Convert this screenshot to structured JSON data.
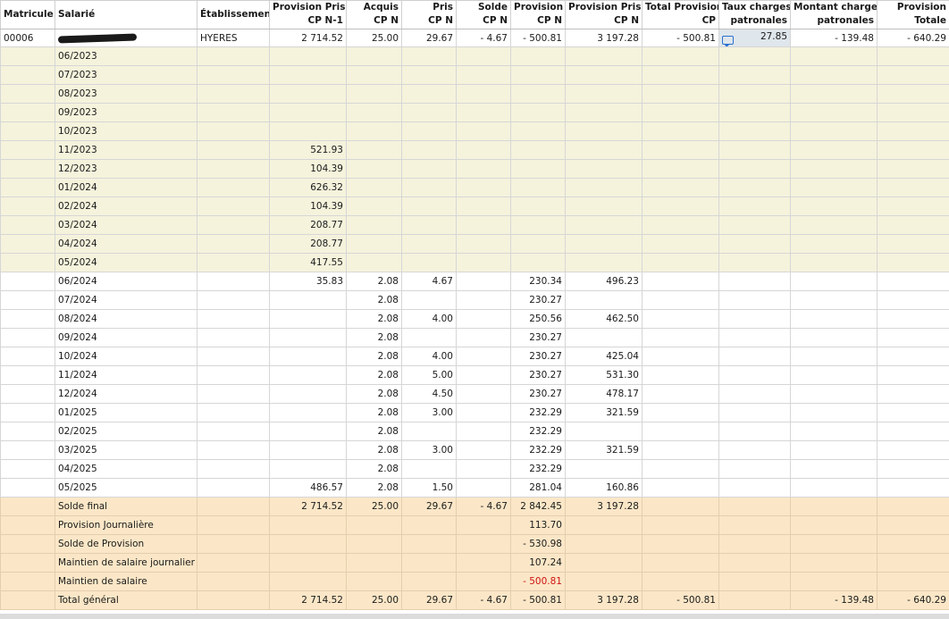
{
  "headers": [
    {
      "l1": "Matricule",
      "l2": "",
      "align": "l"
    },
    {
      "l1": "Salarié",
      "l2": "",
      "align": "l"
    },
    {
      "l1": "Établissement",
      "l2": "",
      "align": "l"
    },
    {
      "l1": "Provision Prise",
      "l2": "CP N-1",
      "align": "r"
    },
    {
      "l1": "Acquis",
      "l2": "CP N",
      "align": "r"
    },
    {
      "l1": "Pris",
      "l2": "CP N",
      "align": "r"
    },
    {
      "l1": "Solde",
      "l2": "CP N",
      "align": "r"
    },
    {
      "l1": "Provision",
      "l2": "CP N",
      "align": "r"
    },
    {
      "l1": "Provision Prise",
      "l2": "CP N",
      "align": "r"
    },
    {
      "l1": "Total Provision",
      "l2": "CP",
      "align": "r"
    },
    {
      "l1": "Taux charges",
      "l2": "patronales",
      "align": "r"
    },
    {
      "l1": "Montant charges",
      "l2": "patronales",
      "align": "r"
    },
    {
      "l1": "Provision",
      "l2": "Totale",
      "align": "r"
    }
  ],
  "employee": {
    "matricule": "00006",
    "etablissement": "HYERES",
    "prov_prise_n1": "2 714.52",
    "acquis": "25.00",
    "pris": "29.67",
    "solde": "- 4.67",
    "provision": "- 500.81",
    "prov_prise_n": "3 197.28",
    "total_provision": "- 500.81",
    "taux": "27.85",
    "montant_charges": "- 139.48",
    "provision_totale": "- 640.29"
  },
  "months_prev": [
    {
      "month": "06/2023",
      "prov_prise_n1": ""
    },
    {
      "month": "07/2023",
      "prov_prise_n1": ""
    },
    {
      "month": "08/2023",
      "prov_prise_n1": ""
    },
    {
      "month": "09/2023",
      "prov_prise_n1": ""
    },
    {
      "month": "10/2023",
      "prov_prise_n1": ""
    },
    {
      "month": "11/2023",
      "prov_prise_n1": "521.93"
    },
    {
      "month": "12/2023",
      "prov_prise_n1": "104.39"
    },
    {
      "month": "01/2024",
      "prov_prise_n1": "626.32"
    },
    {
      "month": "02/2024",
      "prov_prise_n1": "104.39"
    },
    {
      "month": "03/2024",
      "prov_prise_n1": "208.77"
    },
    {
      "month": "04/2024",
      "prov_prise_n1": "208.77"
    },
    {
      "month": "05/2024",
      "prov_prise_n1": "417.55"
    }
  ],
  "months_cur": [
    {
      "month": "06/2024",
      "prov_prise_n1": "35.83",
      "acquis": "2.08",
      "pris": "4.67",
      "provision": "230.34",
      "prov_prise_n": "496.23"
    },
    {
      "month": "07/2024",
      "prov_prise_n1": "",
      "acquis": "2.08",
      "pris": "",
      "provision": "230.27",
      "prov_prise_n": ""
    },
    {
      "month": "08/2024",
      "prov_prise_n1": "",
      "acquis": "2.08",
      "pris": "4.00",
      "provision": "250.56",
      "prov_prise_n": "462.50"
    },
    {
      "month": "09/2024",
      "prov_prise_n1": "",
      "acquis": "2.08",
      "pris": "",
      "provision": "230.27",
      "prov_prise_n": ""
    },
    {
      "month": "10/2024",
      "prov_prise_n1": "",
      "acquis": "2.08",
      "pris": "4.00",
      "provision": "230.27",
      "prov_prise_n": "425.04"
    },
    {
      "month": "11/2024",
      "prov_prise_n1": "",
      "acquis": "2.08",
      "pris": "5.00",
      "provision": "230.27",
      "prov_prise_n": "531.30"
    },
    {
      "month": "12/2024",
      "prov_prise_n1": "",
      "acquis": "2.08",
      "pris": "4.50",
      "provision": "230.27",
      "prov_prise_n": "478.17"
    },
    {
      "month": "01/2025",
      "prov_prise_n1": "",
      "acquis": "2.08",
      "pris": "3.00",
      "provision": "232.29",
      "prov_prise_n": "321.59"
    },
    {
      "month": "02/2025",
      "prov_prise_n1": "",
      "acquis": "2.08",
      "pris": "",
      "provision": "232.29",
      "prov_prise_n": ""
    },
    {
      "month": "03/2025",
      "prov_prise_n1": "",
      "acquis": "2.08",
      "pris": "3.00",
      "provision": "232.29",
      "prov_prise_n": "321.59"
    },
    {
      "month": "04/2025",
      "prov_prise_n1": "",
      "acquis": "2.08",
      "pris": "",
      "provision": "232.29",
      "prov_prise_n": ""
    },
    {
      "month": "05/2025",
      "prov_prise_n1": "486.57",
      "acquis": "2.08",
      "pris": "1.50",
      "provision": "281.04",
      "prov_prise_n": "160.86"
    }
  ],
  "summary": [
    {
      "label": "Solde final",
      "prov_prise_n1": "2 714.52",
      "acquis": "25.00",
      "pris": "29.67",
      "solde": "- 4.67",
      "provision": "2 842.45",
      "prov_prise_n": "3 197.28",
      "negative": false
    },
    {
      "label": "Provision Journalière",
      "prov_prise_n1": "",
      "acquis": "",
      "pris": "",
      "solde": "",
      "provision": "113.70",
      "prov_prise_n": "",
      "negative": false
    },
    {
      "label": "Solde de Provision",
      "prov_prise_n1": "",
      "acquis": "",
      "pris": "",
      "solde": "",
      "provision": "- 530.98",
      "prov_prise_n": "",
      "negative": false
    },
    {
      "label": "Maintien de salaire journalier",
      "prov_prise_n1": "",
      "acquis": "",
      "pris": "",
      "solde": "",
      "provision": "107.24",
      "prov_prise_n": "",
      "negative": false
    },
    {
      "label": "Maintien de salaire",
      "prov_prise_n1": "",
      "acquis": "",
      "pris": "",
      "solde": "",
      "provision": "- 500.81",
      "prov_prise_n": "",
      "negative": true
    }
  ],
  "total": {
    "label": "Total général",
    "prov_prise_n1": "2 714.52",
    "acquis": "25.00",
    "pris": "29.67",
    "solde": "- 4.67",
    "provision": "- 500.81",
    "prov_prise_n": "3 197.28",
    "total_provision": "- 500.81",
    "taux": "",
    "montant_charges": "- 139.48",
    "provision_totale": "- 640.29"
  },
  "colors": {
    "prev_year_row": "#f5f3dc",
    "summary_row": "#fbe7c7",
    "negative_text": "#d01010",
    "selected_cell": "#dfe6ec",
    "comment_icon": "#2a6fcf"
  },
  "icons": {
    "comment": "comment-icon",
    "redaction": "redacted-name"
  }
}
